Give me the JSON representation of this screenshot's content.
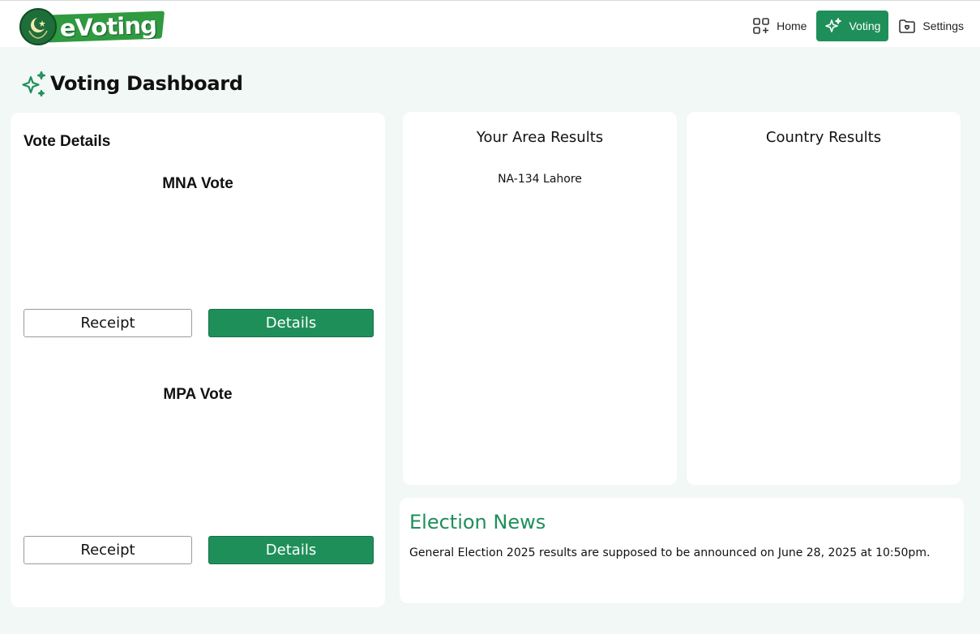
{
  "header": {
    "logo_text": "eVoting",
    "nav": [
      {
        "label": "Home",
        "icon": "grid-plus-icon",
        "active": false
      },
      {
        "label": "Voting",
        "icon": "sparkles-icon",
        "active": true
      },
      {
        "label": "Settings",
        "icon": "settings-folder-icon",
        "active": false
      }
    ]
  },
  "page": {
    "title": "Voting Dashboard",
    "title_icon": "sparkles-icon"
  },
  "vote_details": {
    "title": "Vote Details",
    "sections": [
      {
        "title": "MNA Vote",
        "receipt_label": "Receipt",
        "details_label": "Details"
      },
      {
        "title": "MPA Vote",
        "receipt_label": "Receipt",
        "details_label": "Details"
      }
    ]
  },
  "area_results": {
    "title": "Your Area Results",
    "constituency": "NA-134 Lahore"
  },
  "country_results": {
    "title": "Country Results"
  },
  "news": {
    "title": "Election News",
    "text": "General Election 2025 results are supposed to be announced on June 28, 2025 at 10:50pm."
  },
  "colors": {
    "accent": "#1f8f5a",
    "background": "#f1f8f5",
    "card": "#ffffff"
  }
}
